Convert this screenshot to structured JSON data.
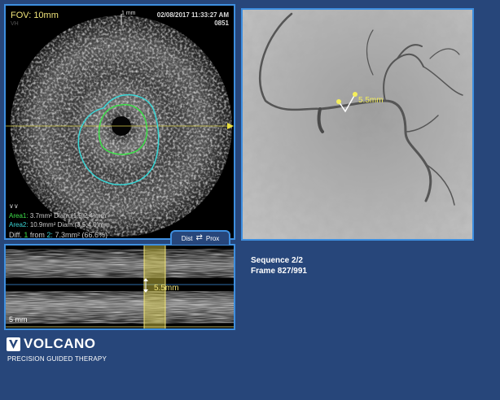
{
  "ivus": {
    "fov": "FOV: 10mm",
    "vh": "VH",
    "scale_top": "1 mm",
    "datetime": "02/08/2017 11:33:27 AM",
    "frame_id": "0851",
    "collapse_icon": "double-chevron-down-icon",
    "area1": {
      "label": "Area1:",
      "value": "3.7mm² Diam:(1.9;2.4)mm"
    },
    "area2": {
      "label": "Area2:",
      "value": "10.9mm² Diam:(3.5;4.0)mm"
    },
    "diff": {
      "prefix": "Diff.",
      "a": "1",
      "mid": "from",
      "b": "2:",
      "value": "7.3mm²  (66.6%)"
    }
  },
  "direction_tab": {
    "dist": "Dist",
    "prox": "Prox",
    "icon": "swap-arrows-icon"
  },
  "longitudinal": {
    "scale": "5 mm",
    "measure": "5.5mm"
  },
  "angio": {
    "measure": "5.5mm"
  },
  "info": {
    "sequence": "Sequence 2/2",
    "frame": "Frame 827/991"
  },
  "brand": {
    "name": "VOLCANO",
    "tagline": "PRECISION GUIDED THERAPY"
  },
  "colors": {
    "accent_border": "#3e8fe0",
    "background": "#27467a",
    "measure_yellow": "#f0e47a",
    "lumen_green": "#3ee04a",
    "vessel_cyan": "#3ad7d7"
  }
}
